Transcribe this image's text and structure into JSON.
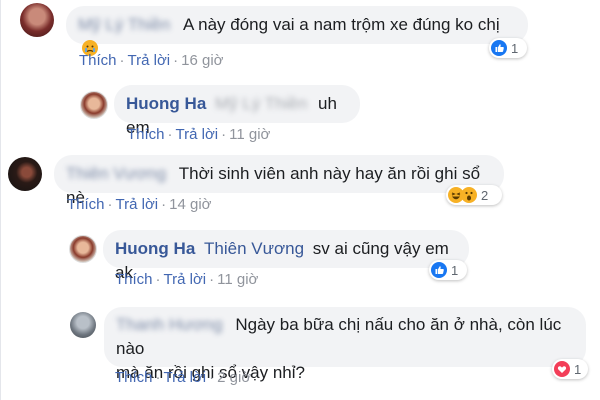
{
  "comments": [
    {
      "name_blurred": "Mỹ Lý Thiền",
      "text": "A này đóng vai a nam trộm xe đúng ko chị",
      "emoji": "sad-emoji",
      "actions": {
        "like": "Thích",
        "sep": "·",
        "reply": "Trả lời",
        "time": "16 giờ"
      },
      "reaction": {
        "icons": [
          "like-icon"
        ],
        "count": "1"
      }
    },
    {
      "author": "Huong Ha",
      "mention_blurred": "Mỹ Lý Thiền",
      "text": "uh em",
      "actions": {
        "like": "Thích",
        "sep": "·",
        "reply": "Trả lời",
        "time": "11 giờ"
      }
    },
    {
      "name_blurred": "Thiên Vương",
      "text": "Thời sinh viên anh này hay ăn rồi ghi sổ nè",
      "actions": {
        "like": "Thích",
        "sep": "·",
        "reply": "Trả lời",
        "time": "14 giờ"
      },
      "reaction": {
        "icons": [
          "haha-icon",
          "wow-icon"
        ],
        "count": "2"
      }
    },
    {
      "author": "Huong Ha",
      "mention": "Thiên Vương",
      "text": "sv ai cũng vậy em ak",
      "actions": {
        "like": "Thích",
        "sep": "·",
        "reply": "Trả lời",
        "time": "11 giờ"
      },
      "reaction": {
        "icons": [
          "like-icon"
        ],
        "count": "1"
      }
    },
    {
      "name_blurred": "Thanh Hương",
      "text_line1": "Ngày ba bữa chị nấu cho ăn ở nhà, còn lúc nào",
      "text_line2": "mà ăn rồi ghi sổ vậy nhỉ?",
      "actions": {
        "like": "Thích",
        "sep": "·",
        "reply": "Trả lời",
        "time": "2 giờ"
      },
      "reaction": {
        "icons": [
          "love-icon"
        ],
        "count": "1"
      }
    }
  ],
  "colors": {
    "bubble": "#f2f3f5",
    "author": "#385898",
    "link": "#4267b2",
    "meta": "#90949c",
    "like": "#1877f2",
    "love": "#f33e58",
    "emoji": "#f7b125"
  }
}
